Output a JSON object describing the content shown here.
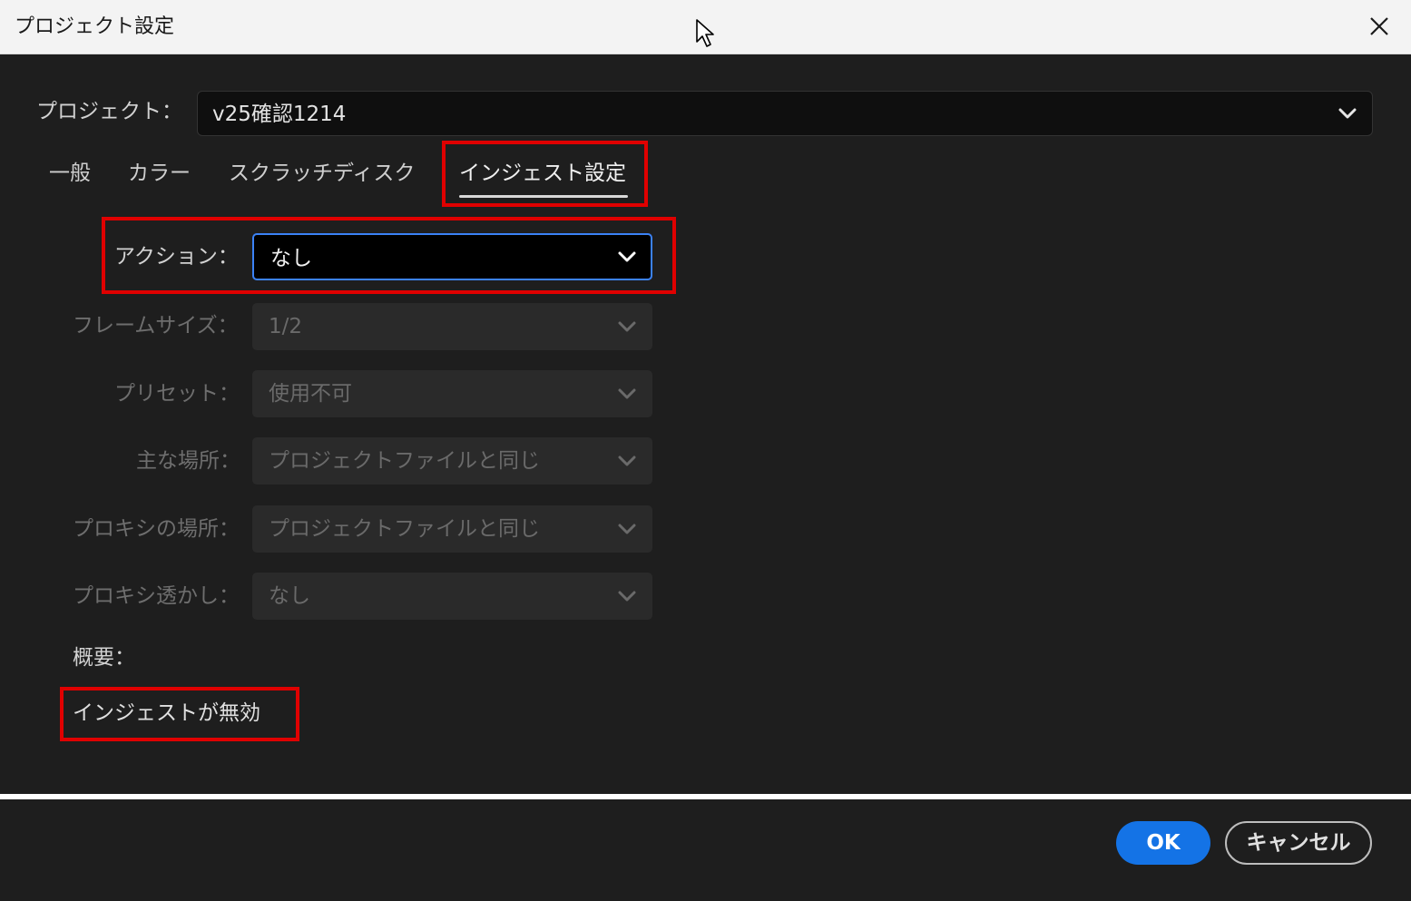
{
  "window": {
    "title": "プロジェクト設定",
    "close_icon": "close-icon",
    "cursor_icon": "mouse-pointer-icon"
  },
  "project": {
    "label": "プロジェクト：",
    "value": "v25確認1214"
  },
  "tabs": [
    {
      "label": "一般"
    },
    {
      "label": "カラー"
    },
    {
      "label": "スクラッチディスク"
    },
    {
      "label": "インジェスト設定",
      "active": true
    }
  ],
  "ingest": {
    "action": {
      "label": "アクション：",
      "value": "なし"
    },
    "frame_size": {
      "label": "フレームサイズ：",
      "value": "1/2"
    },
    "preset": {
      "label": "プリセット：",
      "value": "使用不可"
    },
    "primary_dest": {
      "label": "主な場所：",
      "value": "プロジェクトファイルと同じ"
    },
    "proxy_dest": {
      "label": "プロキシの場所：",
      "value": "プロジェクトファイルと同じ"
    },
    "proxy_watermark": {
      "label": "プロキシ透かし：",
      "value": "なし"
    }
  },
  "summary": {
    "label": "概要：",
    "text": "インジェストが無効"
  },
  "footer": {
    "ok_label": "OK",
    "cancel_label": "キャンセル"
  },
  "colors": {
    "accent": "#1473e6",
    "focus_ring": "#3b82f6",
    "highlight_box": "#e00000",
    "panel_bg": "#1e1e1e"
  }
}
